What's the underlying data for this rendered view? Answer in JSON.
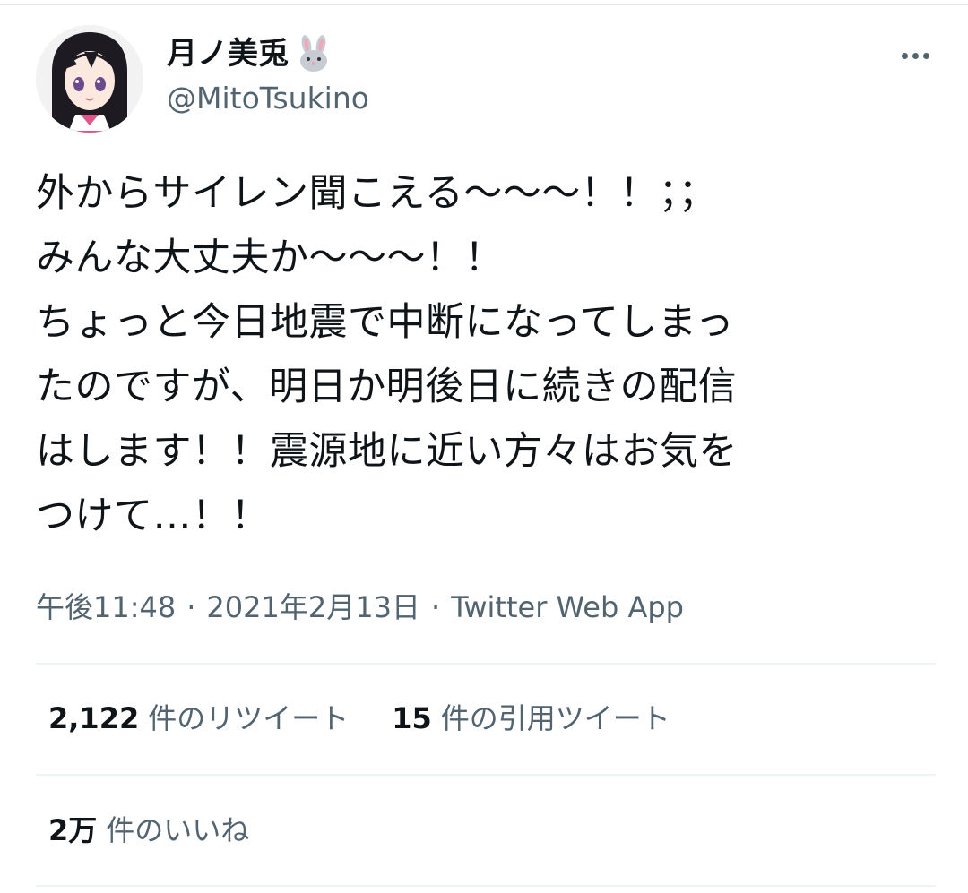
{
  "author": {
    "display_name": "月ノ美兎",
    "emoji": "rabbit-face",
    "handle": "@MitoTsukino"
  },
  "tweet": {
    "lines": [
      "外からサイレン聞こえる〜〜〜！！；；",
      "みんな大丈夫か〜〜〜！！",
      "ちょっと今日地震で中断になってしまっ",
      "たのですが、明日か明後日に続きの配信",
      "はします！！震源地に近い方々はお気を",
      "つけて…！！"
    ]
  },
  "meta": {
    "time": "午後11:48",
    "separator": "·",
    "date": "2021年2月13日",
    "source": "Twitter Web App"
  },
  "stats": {
    "retweets": {
      "count": "2,122",
      "label": "件のリツイート"
    },
    "quotes": {
      "count": "15",
      "label": "件の引用ツイート"
    },
    "likes": {
      "count": "2万",
      "label": "件のいいね"
    }
  }
}
